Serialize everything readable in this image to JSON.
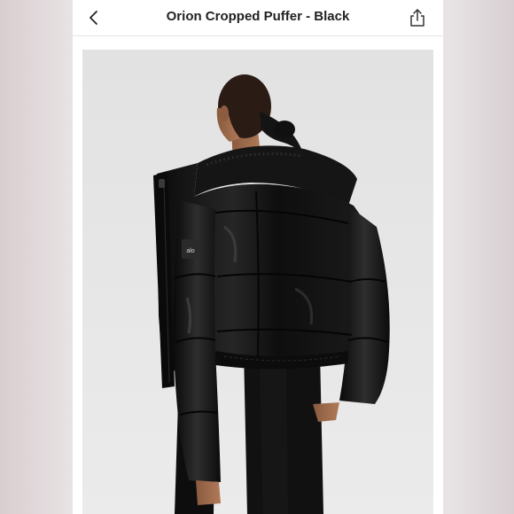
{
  "header": {
    "title": "Orion Cropped Puffer - Black",
    "back_icon": "chevron-left-icon",
    "share_icon": "share-icon"
  },
  "product_image": {
    "brand_patch_text": "alo",
    "background_color": "#e6e6e6",
    "garment_color": "#121212"
  },
  "colors": {
    "title_text": "#222222",
    "toolbar_bg": "#ffffff",
    "divider": "#e4e4e4"
  }
}
